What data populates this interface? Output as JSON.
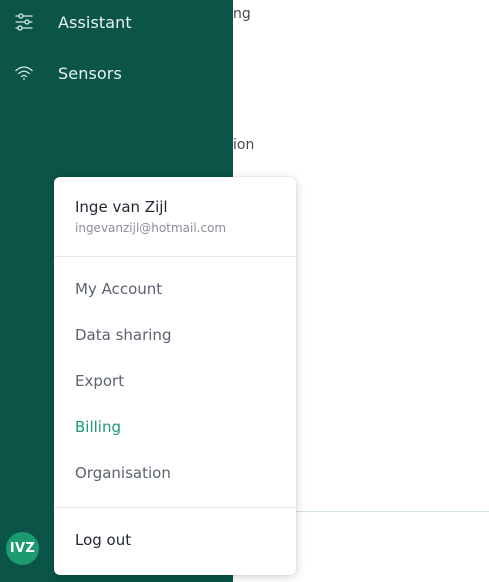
{
  "sidebar": {
    "items": [
      {
        "label": "Assistant",
        "icon": "sliders-icon"
      },
      {
        "label": "Sensors",
        "icon": "wifi-icon"
      }
    ],
    "avatar_initials": "IVZ"
  },
  "main": {
    "snippets": [
      "ng",
      "ion"
    ]
  },
  "menu": {
    "user_name": "Inge van Zijl",
    "user_email": "ingevanzijl@hotmail.com",
    "items": [
      {
        "label": "My Account"
      },
      {
        "label": "Data sharing"
      },
      {
        "label": "Export"
      },
      {
        "label": "Billing",
        "active": true
      },
      {
        "label": "Organisation"
      }
    ],
    "logout_label": "Log out"
  },
  "colors": {
    "sidebar_bg": "#0a5548",
    "accent": "#1c9a72",
    "avatar_bg": "#1c9a72"
  }
}
